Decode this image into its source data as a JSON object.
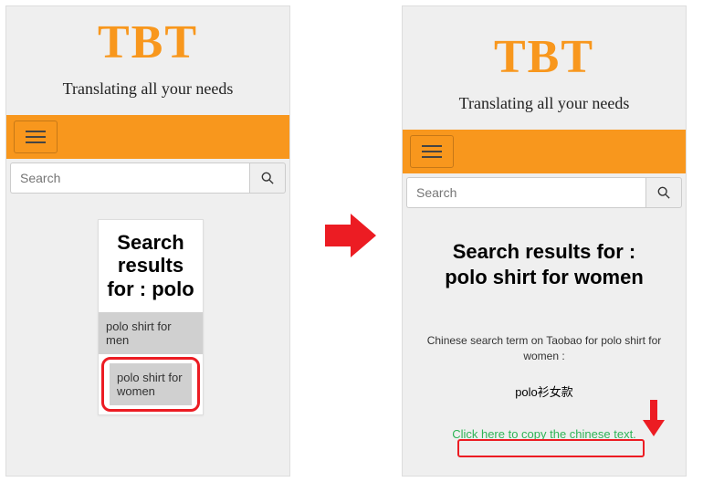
{
  "brand": {
    "logo": "TBT",
    "tagline": "Translating all your needs"
  },
  "search": {
    "placeholder": "Search"
  },
  "left": {
    "results_heading": "Search results for : polo",
    "items": [
      "polo shirt for men",
      "polo shirt for women"
    ]
  },
  "right": {
    "heading_line1": "Search results for :",
    "heading_line2": "polo shirt for women",
    "sub": "Chinese search term on Taobao for polo shirt for women :",
    "chinese": "polo衫女款",
    "copy_link": "Click here to copy the chinese text."
  },
  "icons": {
    "search": "search-icon",
    "menu": "hamburger-icon"
  }
}
